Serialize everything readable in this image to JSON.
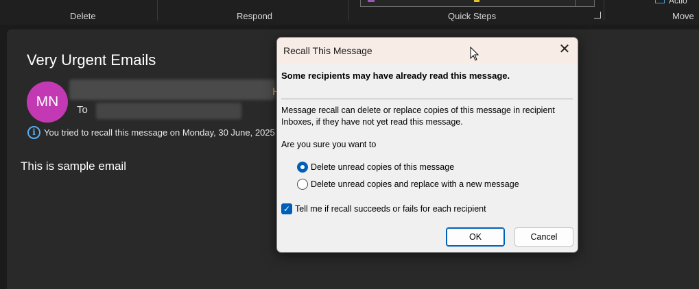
{
  "ribbon": {
    "groups": [
      "Delete",
      "Respond",
      "Quick Steps",
      "Move"
    ],
    "move_partial_label": "Actio",
    "colors": {
      "accent": "#4aa3df",
      "quickstep_purple": "#9b59b6",
      "quickstep_yellow": "#e6c229"
    }
  },
  "message": {
    "subject": "Very Urgent Emails",
    "avatar_initials": "MN",
    "avatar_color": "#c239b3",
    "sender_partial_tail": "H",
    "to_label": "To",
    "info_text": "You tried to recall this message on Monday, 30 June, 2025",
    "body": "This is sample email"
  },
  "dialog": {
    "title": "Recall This Message",
    "close_icon": "close-icon",
    "warning": "Some recipients may have already read this message.",
    "description": "Message recall can delete or replace copies of this message in recipient Inboxes, if they have not yet read this message.",
    "question": "Are you sure you want to",
    "options": [
      {
        "label": "Delete unread copies of this message",
        "selected": true
      },
      {
        "label": "Delete unread copies and replace with a new message",
        "selected": false
      }
    ],
    "notify_checkbox": {
      "label": "Tell me if recall succeeds or fails for each recipient",
      "checked": true
    },
    "ok_label": "OK",
    "cancel_label": "Cancel",
    "primary_color": "#005fb8"
  }
}
